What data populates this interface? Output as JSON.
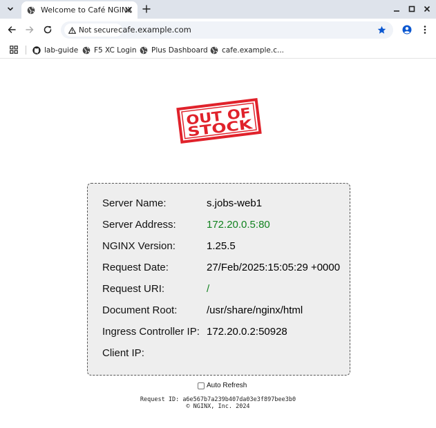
{
  "browser": {
    "tab": {
      "title": "Welcome to Café NGINX"
    },
    "omnibox": {
      "security_label": "Not secure",
      "url": "cafe.example.com"
    },
    "bookmarks": [
      {
        "label": "lab-guide",
        "icon": "github-icon"
      },
      {
        "label": "F5 XC Login",
        "icon": "globe-icon"
      },
      {
        "label": "Plus Dashboard",
        "icon": "globe-icon"
      },
      {
        "label": "cafe.example.c...",
        "icon": "globe-icon"
      }
    ],
    "colors": {
      "tabstrip": "#dee3eb",
      "omnibox": "#f0f3f8",
      "accent": "#0b57d0"
    }
  },
  "page": {
    "stamp": {
      "line1": "OUT OF",
      "line2": "STOCK",
      "color": "#e0222b"
    },
    "info": [
      {
        "label": "Server Name:",
        "value": "s.jobs-web1",
        "value_color": "#111111"
      },
      {
        "label": "Server Address:",
        "value": "172.20.0.5:80",
        "value_color": "#11821f"
      },
      {
        "label": "NGINX Version:",
        "value": "1.25.5",
        "value_color": "#111111"
      },
      {
        "label": "Request Date:",
        "value": "27/Feb/2025:15:05:29 +0000",
        "value_color": "#111111"
      },
      {
        "label": "Request URI:",
        "value": "/",
        "value_color": "#11821f"
      },
      {
        "label": "Document Root:",
        "value": "/usr/share/nginx/html",
        "value_color": "#111111"
      },
      {
        "label": "Ingress Controller IP:",
        "value": "172.20.0.2:50928",
        "value_color": "#111111"
      },
      {
        "label": "Client IP:",
        "value": "",
        "value_color": "#111111"
      }
    ],
    "auto_refresh": {
      "label": "Auto Refresh",
      "checked": false
    },
    "footer": {
      "request_id": "Request ID: a6e567b7a239b407da03e3f897bee3b0",
      "copyright": "© NGINX, Inc. 2024"
    }
  }
}
